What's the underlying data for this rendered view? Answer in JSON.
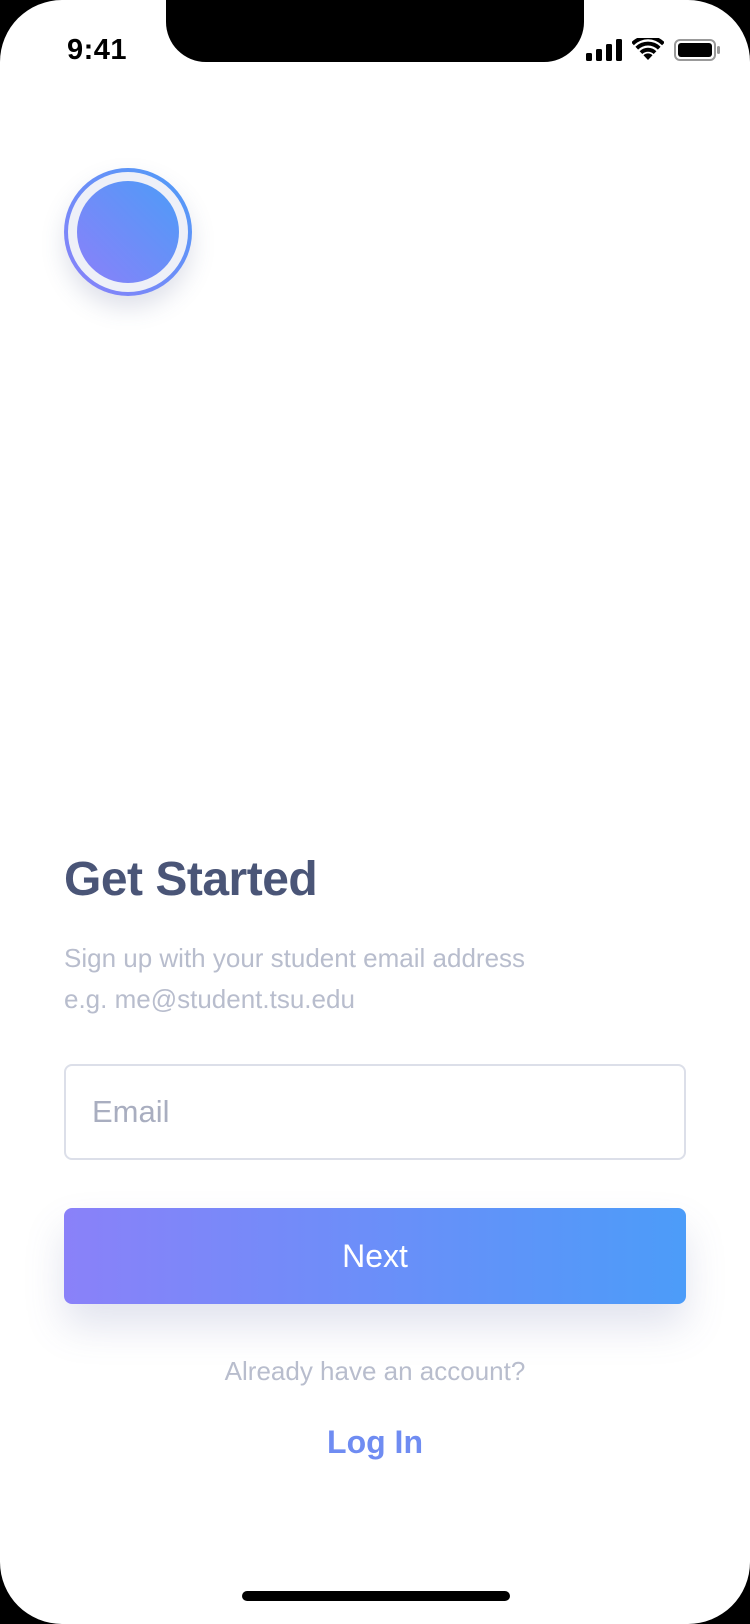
{
  "status_bar": {
    "time": "9:41",
    "icons": [
      "cellular-signal-icon",
      "wifi-icon",
      "battery-icon"
    ]
  },
  "logo": {
    "icon": "app-logo-circle",
    "gradient": [
      "#8b80f9",
      "#4d9cf8"
    ]
  },
  "main": {
    "title": "Get Started",
    "subtitle_line1": "Sign up with your student email address",
    "subtitle_line2": "e.g. me@student.tsu.edu",
    "email_placeholder": "Email",
    "email_value": "",
    "next_label": "Next",
    "already_text": "Already have an account?",
    "login_label": "Log In"
  },
  "colors": {
    "title": "#4a5577",
    "muted_text": "#b8bdcd",
    "link": "#6f8cf2",
    "button_gradient_start": "#8a81f9",
    "button_gradient_end": "#4c9cf9"
  }
}
